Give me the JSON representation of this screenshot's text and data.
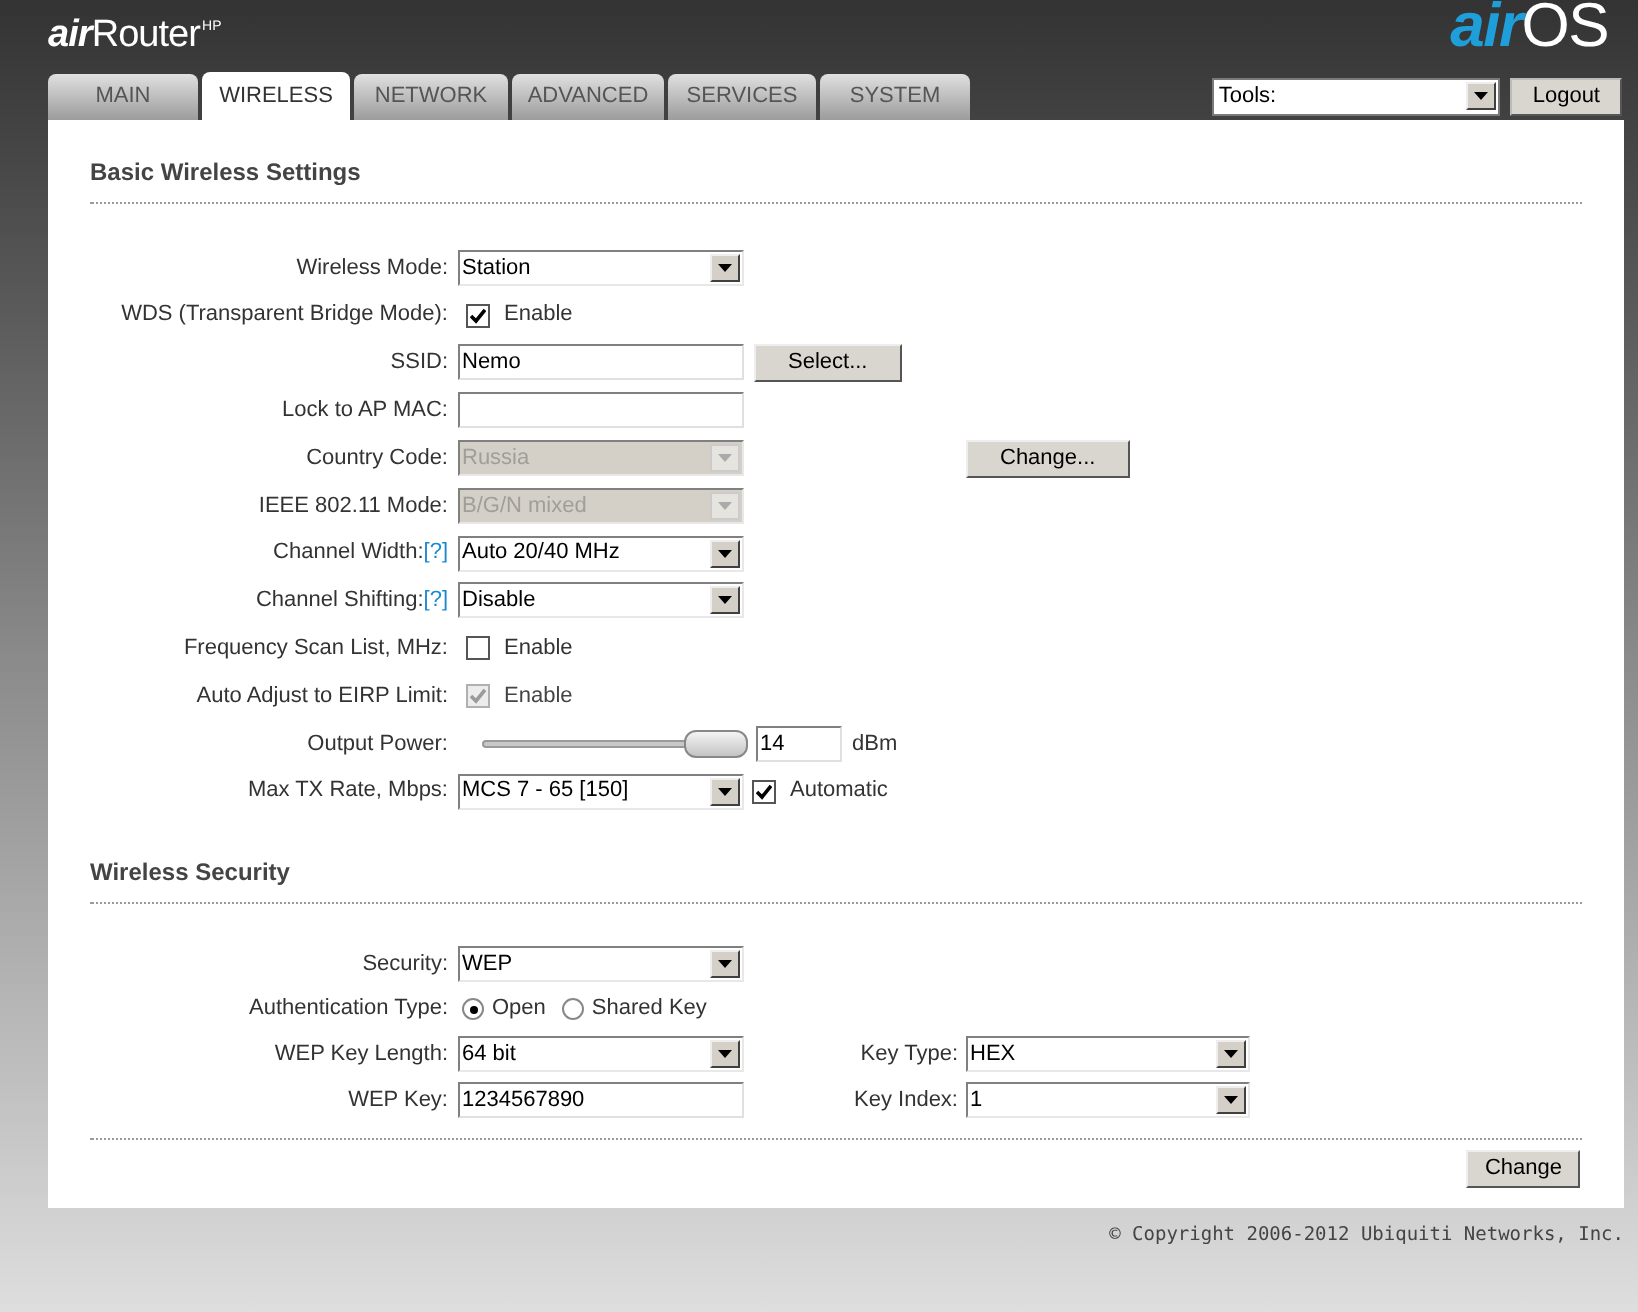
{
  "header": {
    "product_logo": {
      "prefix": "air",
      "name": "Router",
      "suffix": "HP"
    },
    "os_logo": {
      "prefix": "air",
      "name": "OS"
    }
  },
  "tabs": [
    {
      "label": "MAIN",
      "selected": false
    },
    {
      "label": "WIRELESS",
      "selected": true
    },
    {
      "label": "NETWORK",
      "selected": false
    },
    {
      "label": "ADVANCED",
      "selected": false
    },
    {
      "label": "SERVICES",
      "selected": false
    },
    {
      "label": "SYSTEM",
      "selected": false
    }
  ],
  "tools": {
    "value": "Tools:"
  },
  "logout_button": "Logout",
  "sections": [
    {
      "title": "Basic Wireless Settings",
      "rows": [
        {
          "label": "Wireless Mode:",
          "controls": [
            {
              "kind": "select",
              "value": "Station",
              "disabled": false
            }
          ]
        },
        {
          "label": "WDS (Transparent Bridge Mode):",
          "controls": [
            {
              "kind": "checkbox",
              "checked": true,
              "disabled": false,
              "label": "Enable"
            }
          ]
        },
        {
          "label": "SSID:",
          "controls": [
            {
              "kind": "input",
              "value": "Nemo"
            },
            {
              "kind": "button",
              "label": "Select..."
            }
          ]
        },
        {
          "label": "Lock to AP MAC:",
          "controls": [
            {
              "kind": "input"
            }
          ]
        },
        {
          "label": "Country Code:",
          "controls": [
            {
              "kind": "select",
              "value": "Russia",
              "disabled": true
            }
          ],
          "side": {
            "controls": [
              {
                "kind": "button",
                "label": "Change..."
              }
            ]
          }
        },
        {
          "label": "IEEE 802.11 Mode:",
          "controls": [
            {
              "kind": "select",
              "value": "B/G/N mixed",
              "disabled": true
            }
          ]
        },
        {
          "label": "Channel Width:",
          "help": "[?]",
          "controls": [
            {
              "kind": "select",
              "value": "Auto 20/40 MHz",
              "disabled": false
            }
          ]
        },
        {
          "label": "Channel Shifting:",
          "help": "[?]",
          "controls": [
            {
              "kind": "select",
              "value": "Disable",
              "disabled": false
            }
          ]
        },
        {
          "label": "Frequency Scan List, MHz:",
          "controls": [
            {
              "kind": "checkbox",
              "checked": false,
              "disabled": false,
              "label": "Enable"
            }
          ]
        },
        {
          "label": "Auto Adjust to EIRP Limit:",
          "controls": [
            {
              "kind": "checkbox",
              "checked": true,
              "disabled": true,
              "label": "Enable"
            }
          ]
        },
        {
          "label": "Output Power:",
          "controls": [
            {
              "kind": "slider",
              "level": 1
            },
            {
              "kind": "number",
              "value": "14"
            },
            {
              "kind": "unit",
              "text": "dBm"
            }
          ]
        },
        {
          "label": "Max TX Rate, Mbps:",
          "controls": [
            {
              "kind": "select",
              "value": "MCS 7 - 65 [150]",
              "disabled": false
            },
            {
              "kind": "checkbox",
              "checked": true,
              "disabled": false,
              "label": "Automatic"
            }
          ]
        }
      ]
    },
    {
      "title": "Wireless Security",
      "rows": [
        {
          "label": "Security:",
          "controls": [
            {
              "kind": "select",
              "value": "WEP",
              "disabled": false
            }
          ]
        },
        {
          "label": "Authentication Type:",
          "controls": [
            {
              "kind": "radio",
              "label": "Open",
              "selected": true
            },
            {
              "kind": "radio",
              "label": "Shared Key",
              "selected": false
            }
          ]
        },
        {
          "label": "WEP Key Length:",
          "controls": [
            {
              "kind": "select",
              "value": "64 bit",
              "disabled": false
            }
          ],
          "side": {
            "label": "Key Type:",
            "controls": [
              {
                "kind": "select",
                "value": "HEX",
                "disabled": false
              }
            ]
          }
        },
        {
          "label": "WEP Key:",
          "controls": [
            {
              "kind": "input",
              "value": "1234567890"
            }
          ],
          "side": {
            "label": "Key Index:",
            "controls": [
              {
                "kind": "select",
                "value": "1",
                "disabled": false
              }
            ]
          }
        }
      ]
    }
  ],
  "apply_button": "Change",
  "copyright": "© Copyright 2006-2012 Ubiquiti Networks, Inc."
}
